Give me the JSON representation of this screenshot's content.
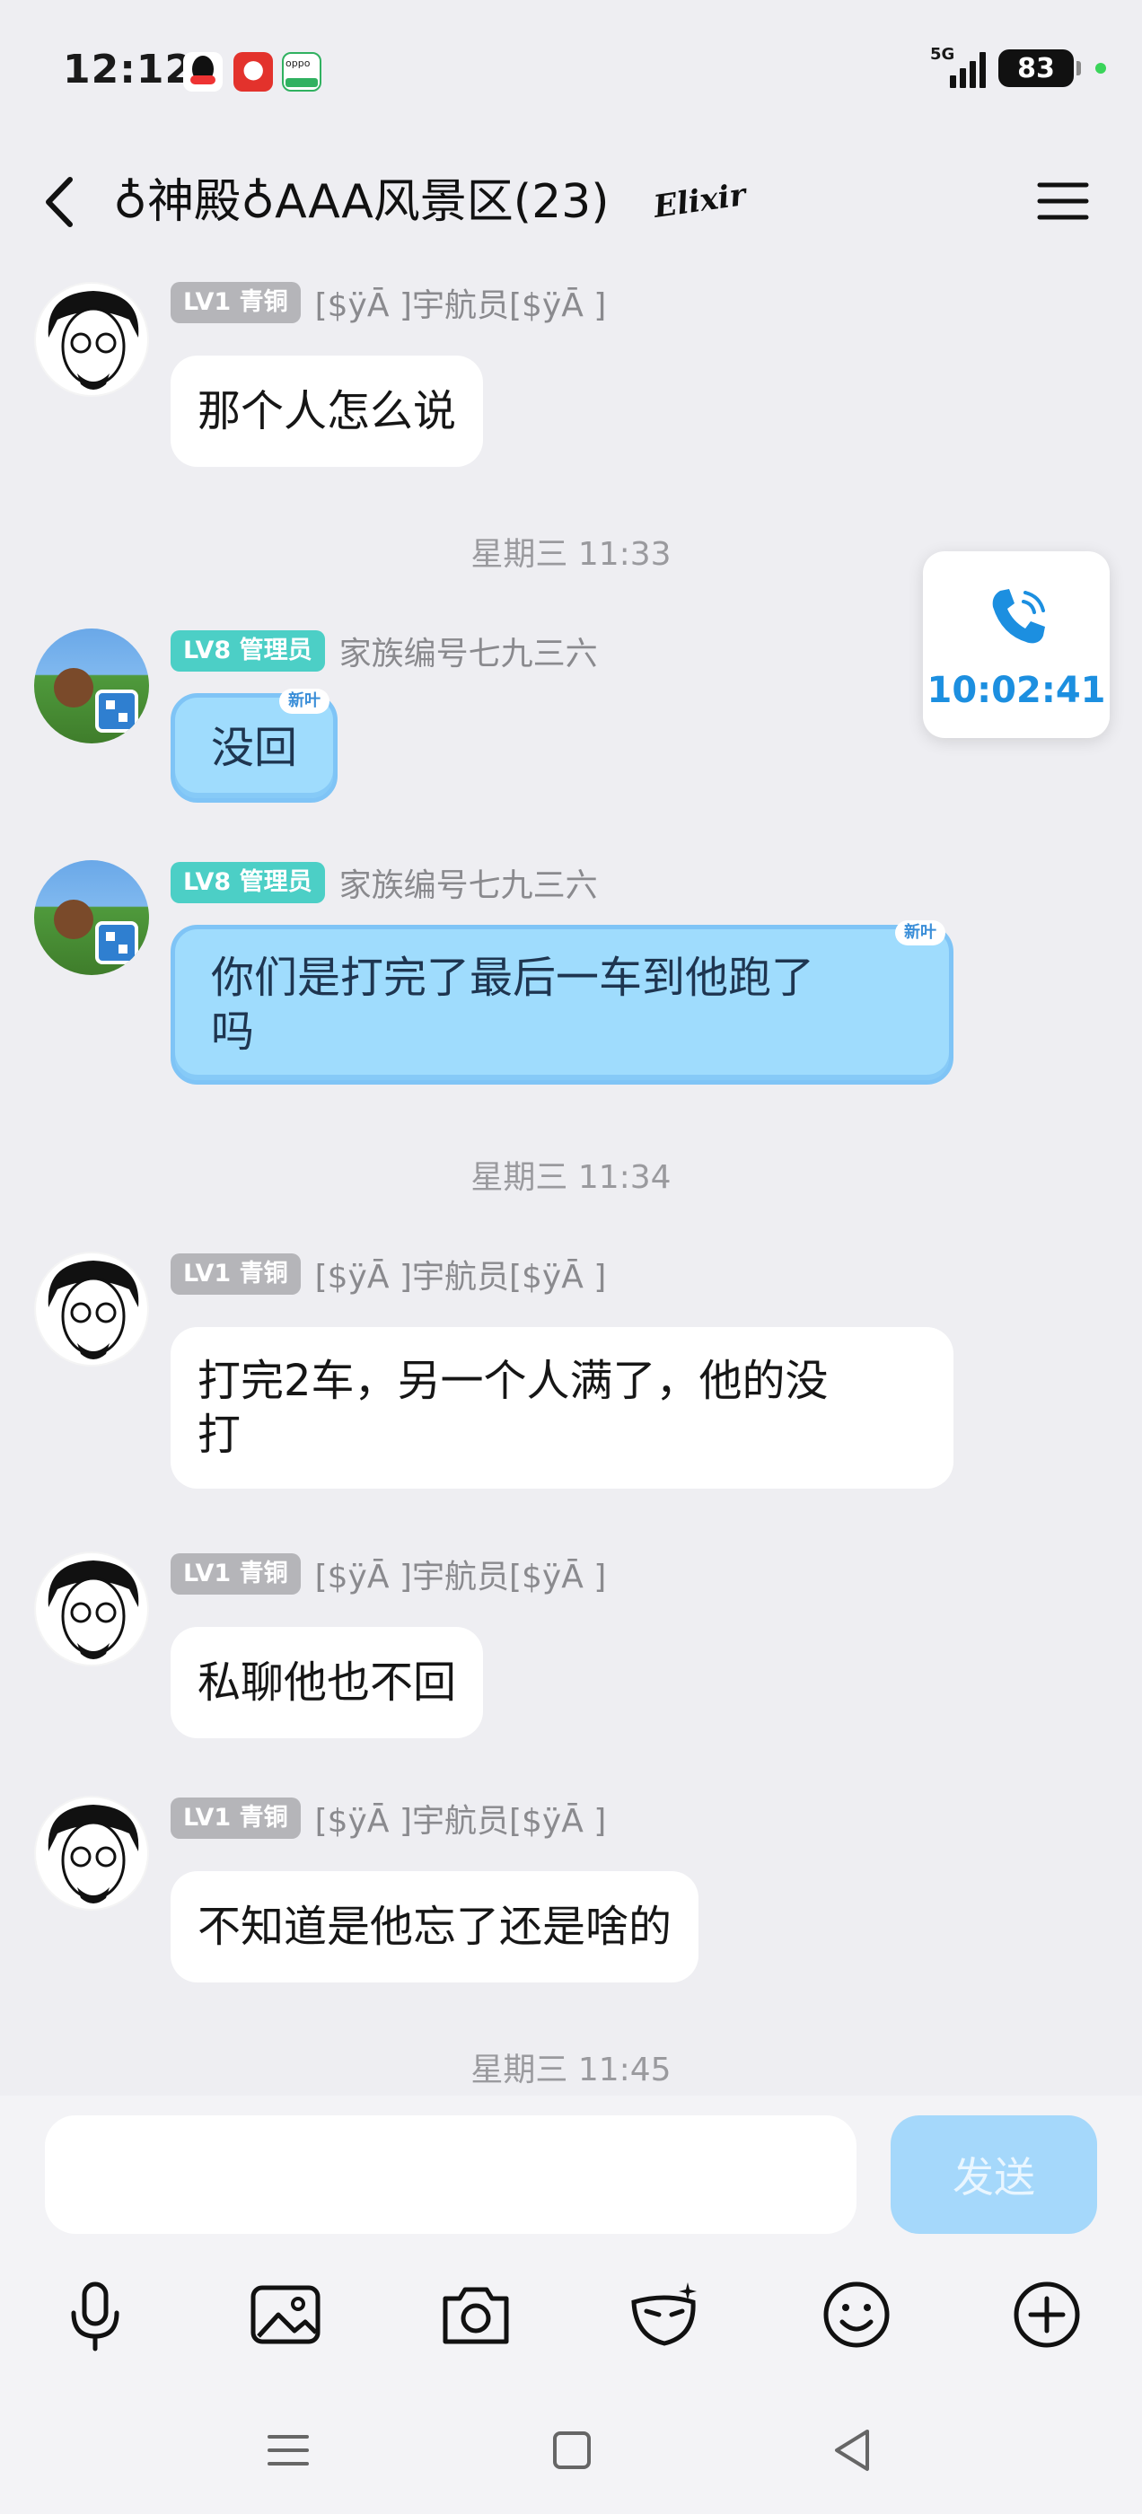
{
  "status_bar": {
    "time": "12:12",
    "network": "5G",
    "battery": "83"
  },
  "header": {
    "title": "♁神殿♁AAA风景区(23)",
    "badge_text": "Elixir"
  },
  "messages": [
    {
      "level": "LV1 青铜",
      "sender": "[$ÿĀ ]宇航员[$ÿĀ ]",
      "text": "那个人怎么说"
    },
    {
      "level": "LV8 管理员",
      "sender": "家族编号七九三六",
      "text": "没回",
      "tag": "新叶"
    },
    {
      "level": "LV8 管理员",
      "sender": "家族编号七九三六",
      "text_line1": "你们是打完了最后一车到他跑了",
      "text_line2": "吗",
      "tag": "新叶"
    },
    {
      "level": "LV1 青铜",
      "sender": "[$ÿĀ ]宇航员[$ÿĀ ]",
      "text_line1": "打完2车，另一个人满了，他的没",
      "text_line2": "打"
    },
    {
      "level": "LV1 青铜",
      "sender": "[$ÿĀ ]宇航员[$ÿĀ ]",
      "text": "私聊他也不回"
    },
    {
      "level": "LV1 青铜",
      "sender": "[$ÿĀ ]宇航员[$ÿĀ ]",
      "text": "不知道是他忘了还是啥的"
    }
  ],
  "time_separators": [
    "星期三 11:33",
    "星期三 11:34",
    "星期三 11:45"
  ],
  "call": {
    "duration": "10:02:41"
  },
  "input": {
    "placeholder": "",
    "send_label": "发送"
  },
  "toolbar": [
    "microphone-icon",
    "image-icon",
    "camera-icon",
    "mask-icon",
    "emoji-icon",
    "plus-icon"
  ],
  "colors": {
    "accent_blue": "#1c8fe0",
    "bubble_blue": "#9fdcfd",
    "send_button": "#a5d8fb",
    "admin_badge": "#4ccfc6",
    "bronze_badge": "#b5b5b9"
  }
}
